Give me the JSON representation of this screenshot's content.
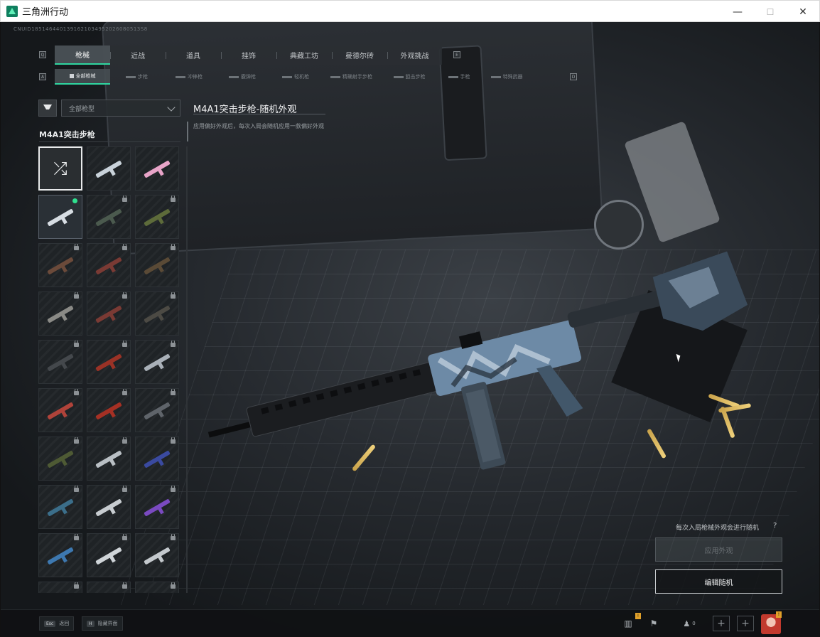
{
  "window": {
    "title": "三角洲行动",
    "minimize": "—",
    "maximize": "☐",
    "close": "✕"
  },
  "build_id": "CNUID1851464401391621034952026080513S8",
  "tabs_primary": {
    "left_key": "Q",
    "right_key": "E",
    "items": [
      {
        "label": "枪械",
        "active": true
      },
      {
        "label": "近战",
        "active": false
      },
      {
        "label": "道具",
        "active": false
      },
      {
        "label": "挂饰",
        "active": false
      },
      {
        "label": "典藏工坊",
        "active": false
      },
      {
        "label": "曼德尔砖",
        "active": false
      },
      {
        "label": "外观挑战",
        "active": false
      }
    ]
  },
  "tabs_secondary": {
    "left_key": "A",
    "right_key": "D",
    "items": [
      {
        "label": "全部枪械",
        "active": true
      },
      {
        "label": "步枪",
        "active": false
      },
      {
        "label": "冲锋枪",
        "active": false
      },
      {
        "label": "霰弹枪",
        "active": false
      },
      {
        "label": "轻机枪",
        "active": false
      },
      {
        "label": "精确射手步枪",
        "active": false
      },
      {
        "label": "狙击步枪",
        "active": false
      },
      {
        "label": "手枪",
        "active": false
      },
      {
        "label": "特殊武器",
        "active": false
      }
    ]
  },
  "filter": {
    "select_value": "全部枪型"
  },
  "weapon_heading": "M4A1突击步枪",
  "skin_tiles": [
    {
      "kind": "random",
      "locked": false,
      "equipped": false,
      "color": "#2a2e31"
    },
    {
      "kind": "skin",
      "locked": false,
      "equipped": false,
      "color": "#c9d2da"
    },
    {
      "kind": "skin",
      "locked": false,
      "equipped": false,
      "color": "#e8a4c8"
    },
    {
      "kind": "skin",
      "locked": false,
      "equipped": true,
      "color": "#d7dde3"
    },
    {
      "kind": "skin",
      "locked": true,
      "equipped": false,
      "color": "#4b5a4e"
    },
    {
      "kind": "skin",
      "locked": true,
      "equipped": false,
      "color": "#5d6b3a"
    },
    {
      "kind": "skin",
      "locked": true,
      "equipped": false,
      "color": "#6b4a3a"
    },
    {
      "kind": "skin",
      "locked": true,
      "equipped": false,
      "color": "#7a3a34"
    },
    {
      "kind": "skin",
      "locked": true,
      "equipped": false,
      "color": "#5a4a36"
    },
    {
      "kind": "skin",
      "locked": true,
      "equipped": false,
      "color": "#8a8a86"
    },
    {
      "kind": "skin",
      "locked": true,
      "equipped": false,
      "color": "#7a3a34"
    },
    {
      "kind": "skin",
      "locked": true,
      "equipped": false,
      "color": "#4c4a44"
    },
    {
      "kind": "skin",
      "locked": true,
      "equipped": false,
      "color": "#44484c"
    },
    {
      "kind": "skin",
      "locked": true,
      "equipped": false,
      "color": "#9a3226"
    },
    {
      "kind": "skin",
      "locked": true,
      "equipped": false,
      "color": "#a9b0b8"
    },
    {
      "kind": "skin",
      "locked": true,
      "equipped": false,
      "color": "#b0433a"
    },
    {
      "kind": "skin",
      "locked": true,
      "equipped": false,
      "color": "#a53024"
    },
    {
      "kind": "skin",
      "locked": true,
      "equipped": false,
      "color": "#5f646a"
    },
    {
      "kind": "skin",
      "locked": true,
      "equipped": false,
      "color": "#4e5a34"
    },
    {
      "kind": "skin",
      "locked": true,
      "equipped": false,
      "color": "#b9bfc4"
    },
    {
      "kind": "skin",
      "locked": true,
      "equipped": false,
      "color": "#3a4aa0"
    },
    {
      "kind": "skin",
      "locked": true,
      "equipped": false,
      "color": "#3b6e8a"
    },
    {
      "kind": "skin",
      "locked": true,
      "equipped": false,
      "color": "#c7ccd0"
    },
    {
      "kind": "skin",
      "locked": true,
      "equipped": false,
      "color": "#7a4ac0"
    },
    {
      "kind": "skin",
      "locked": true,
      "equipped": false,
      "color": "#3d78b0"
    },
    {
      "kind": "skin",
      "locked": true,
      "equipped": false,
      "color": "#cfd4d8"
    },
    {
      "kind": "skin",
      "locked": true,
      "equipped": false,
      "color": "#c4c9cd"
    },
    {
      "kind": "skin",
      "locked": true,
      "equipped": false,
      "color": "#3a3f44"
    },
    {
      "kind": "skin",
      "locked": true,
      "equipped": false,
      "color": "#3a3f44"
    },
    {
      "kind": "skin",
      "locked": true,
      "equipped": false,
      "color": "#3a3f44"
    }
  ],
  "skin_title": "M4A1突击步枪-随机外观",
  "skin_description": "应用偏好外观后，每次入局会随机应用一款偏好外观",
  "random_note": "每次入局枪械外观会进行随机",
  "help_icon": "?",
  "apply_button": "应用外观",
  "edit_random_button": "编辑随机",
  "bottom": {
    "back_key": "Esc",
    "back_label": "返回",
    "hide_key": "H",
    "hide_label": "隐藏界面",
    "friends_count": "0",
    "notif_badge": "!"
  },
  "colors": {
    "accent": "#2fd6a0",
    "equipped": "#2fe08f",
    "warning": "#e0a02a"
  }
}
